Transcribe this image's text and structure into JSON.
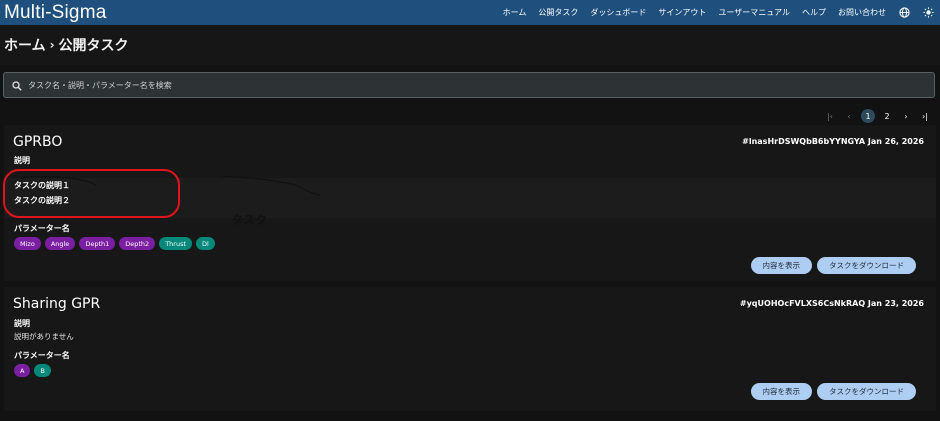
{
  "app": {
    "title": "Multi-Sigma"
  },
  "nav": {
    "items": [
      "ホーム",
      "公開タスク",
      "ダッシュボード",
      "サインアウト",
      "ユーザーマニュアル",
      "ヘルプ",
      "お問い合わせ"
    ],
    "icons": [
      "globe-icon",
      "sun-icon"
    ]
  },
  "breadcrumb": {
    "home": "ホーム",
    "current": "公開タスク"
  },
  "search": {
    "placeholder": "タスク名・説明・パラメーター名を検索"
  },
  "pagination": {
    "pages": [
      "1",
      "2"
    ],
    "current": "1"
  },
  "tasks": [
    {
      "title": "GPRBO",
      "id": "#lnasHrDSWQbB6bYYNGYA",
      "date": "Jan 26, 2026",
      "desc_label": "説明",
      "desc_lines": [
        "タスクの説明１",
        "タスクの説明２"
      ],
      "params_label": "パラメーター名",
      "params": [
        {
          "name": "Mizo",
          "color": "#7b1fa2"
        },
        {
          "name": "Angle",
          "color": "#7b1fa2"
        },
        {
          "name": "Depth1",
          "color": "#7b1fa2"
        },
        {
          "name": "Depth2",
          "color": "#7b1fa2"
        },
        {
          "name": "Thrust",
          "color": "#00897b"
        },
        {
          "name": "Dl",
          "color": "#00897b"
        }
      ],
      "view_label": "内容を表示",
      "download_label": "タスクをダウンロード"
    },
    {
      "title": "Sharing GPR",
      "id": "#yqUOHOcFVLXS6CsNkRAQ",
      "date": "Jan 23, 2026",
      "desc_label": "説明",
      "desc_text": "説明がありません",
      "params_label": "パラメーター名",
      "params": [
        {
          "name": "A",
          "color": "#7b1fa2"
        },
        {
          "name": "B",
          "color": "#00897b"
        }
      ],
      "view_label": "内容を表示",
      "download_label": "タスクをダウンロード"
    }
  ],
  "annotation": {
    "text": "タスク",
    "color": "#e0141b"
  }
}
